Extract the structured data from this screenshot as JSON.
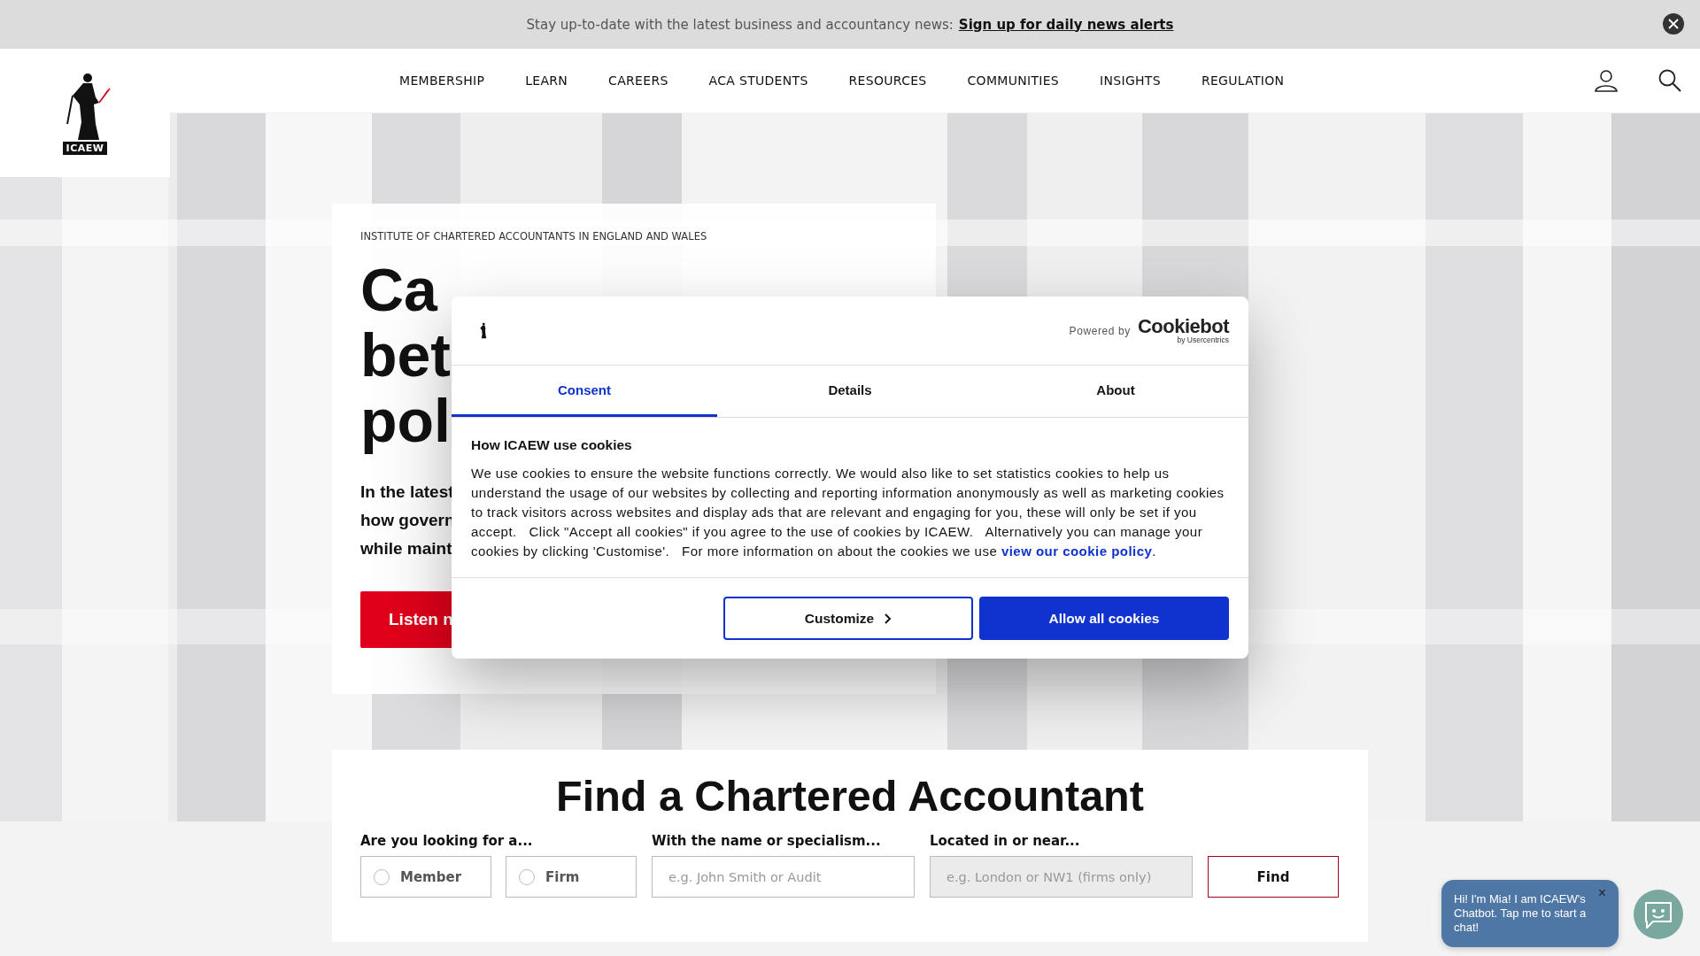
{
  "banner": {
    "text": "Stay up-to-date with the latest business and accountancy news:",
    "link": "Sign up for daily news alerts"
  },
  "logo": {
    "text": "ICAEW"
  },
  "nav": [
    {
      "label": "MEMBERSHIP"
    },
    {
      "label": "LEARN"
    },
    {
      "label": "CAREERS"
    },
    {
      "label": "ACA STUDENTS"
    },
    {
      "label": "RESOURCES"
    },
    {
      "label": "COMMUNITIES"
    },
    {
      "label": "INSIGHTS"
    },
    {
      "label": "REGULATION"
    }
  ],
  "hero": {
    "eyebrow": "INSTITUTE OF CHARTERED ACCOUNTANTS IN ENGLAND AND WALES",
    "headline": [
      "Ca",
      "bet",
      "pol"
    ],
    "intro": [
      "In the latest",
      "how govern",
      "while maint"
    ],
    "button": "Listen n"
  },
  "cookie_dialog": {
    "powered_by": "Powered by",
    "brand": "Cookiebot",
    "brand_sub": "by Usercentrics",
    "tabs": [
      {
        "label": "Consent",
        "selected": true
      },
      {
        "label": "Details",
        "selected": false
      },
      {
        "label": "About",
        "selected": false
      }
    ],
    "heading": "How ICAEW use cookies",
    "body": "We use cookies to ensure the website functions correctly. We would also like to set statistics cookies to help us understand the usage of our websites by collecting and reporting information anonymously as well as marketing cookies to track visitors across websites and display ads that are relevant and engaging for you, these will only be set if you accept.   Click \"Accept all cookies\" if you agree to the use of cookies by ICAEW.   Alternatively you can manage your cookies by clicking 'Customise'.   For more information on about the cookies we use ",
    "link": "view our cookie policy",
    "body_end": ".",
    "buttons": [
      {
        "label": "Customize",
        "kind": "outline"
      },
      {
        "label": "Allow all cookies",
        "kind": "primary"
      }
    ]
  },
  "finder": {
    "title": "Find a Chartered Accountant",
    "type_label": "Are you looking for a...",
    "types": [
      {
        "label": "Member",
        "selected": false
      },
      {
        "label": "Firm",
        "selected": false
      }
    ],
    "name_label": "With the name or specialism...",
    "name_placeholder": "e.g. John Smith or Audit",
    "location_label": "Located in or near...",
    "location_placeholder": "e.g. London or NW1 (firms only)",
    "location_disabled": true,
    "button": "Find"
  },
  "chatbot": {
    "message": "Hi! I'm Mia! I am ICAEW's Chatbot. Tap me to start a chat!",
    "close": "×"
  }
}
